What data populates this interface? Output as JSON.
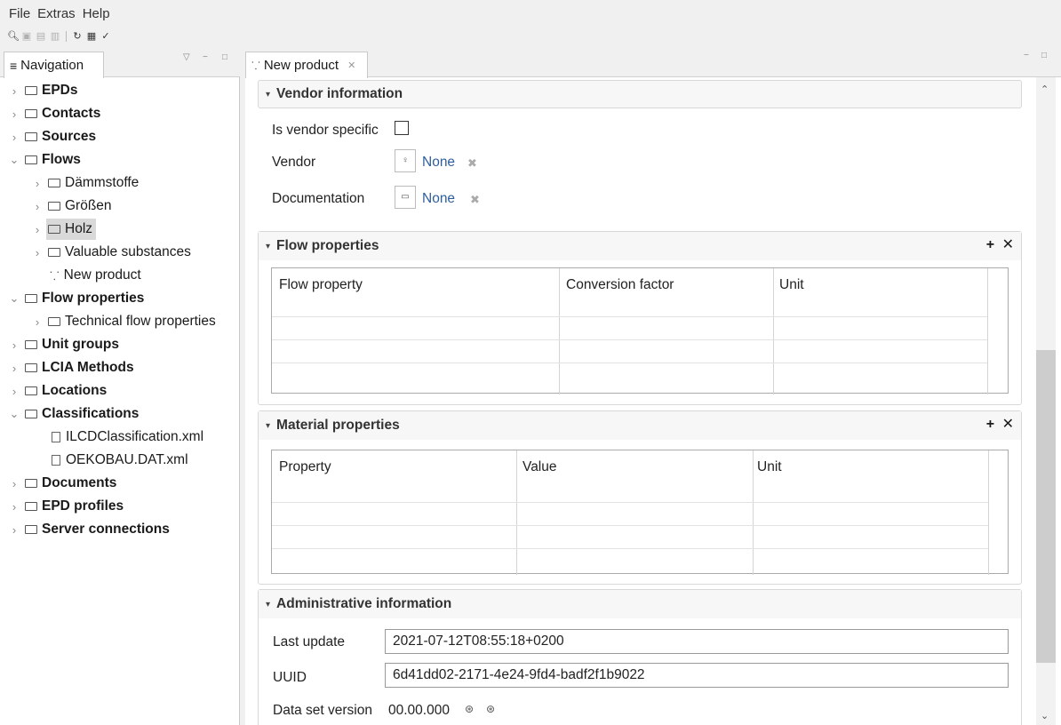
{
  "menubar": {
    "items": [
      "File",
      "Extras",
      "Help"
    ]
  },
  "toolbar": {
    "icons": [
      "search-icon",
      "save-icon",
      "save-as-icon",
      "save-all-icon",
      "refresh-icon",
      "validate-icon",
      "check-icon"
    ]
  },
  "navigation": {
    "tab_label": "Navigation",
    "tree": [
      {
        "label": "EPDs",
        "bold": true,
        "expanded": false,
        "level": 0,
        "kind": "folder"
      },
      {
        "label": "Contacts",
        "bold": true,
        "expanded": false,
        "level": 0,
        "kind": "folder"
      },
      {
        "label": "Sources",
        "bold": true,
        "expanded": false,
        "level": 0,
        "kind": "folder"
      },
      {
        "label": "Flows",
        "bold": true,
        "expanded": true,
        "level": 0,
        "kind": "folder"
      },
      {
        "label": "Dämmstoffe",
        "bold": false,
        "expanded": false,
        "level": 1,
        "kind": "folder"
      },
      {
        "label": "Größen",
        "bold": false,
        "expanded": false,
        "level": 1,
        "kind": "folder"
      },
      {
        "label": "Holz",
        "bold": false,
        "expanded": false,
        "level": 1,
        "kind": "folder",
        "selected": true
      },
      {
        "label": "Valuable substances",
        "bold": false,
        "expanded": false,
        "level": 1,
        "kind": "folder"
      },
      {
        "label": "New product",
        "bold": false,
        "level": 1,
        "kind": "product"
      },
      {
        "label": "Flow properties",
        "bold": true,
        "expanded": true,
        "level": 0,
        "kind": "folder"
      },
      {
        "label": "Technical flow properties",
        "bold": false,
        "expanded": false,
        "level": 1,
        "kind": "folder"
      },
      {
        "label": "Unit groups",
        "bold": true,
        "expanded": false,
        "level": 0,
        "kind": "folder"
      },
      {
        "label": "LCIA Methods",
        "bold": true,
        "expanded": false,
        "level": 0,
        "kind": "folder"
      },
      {
        "label": "Locations",
        "bold": true,
        "expanded": false,
        "level": 0,
        "kind": "folder"
      },
      {
        "label": "Classifications",
        "bold": true,
        "expanded": true,
        "level": 0,
        "kind": "folder"
      },
      {
        "label": "ILCDClassification.xml",
        "bold": false,
        "level": 1,
        "kind": "file"
      },
      {
        "label": "OEKOBAU.DAT.xml",
        "bold": false,
        "level": 1,
        "kind": "file"
      },
      {
        "label": "Documents",
        "bold": true,
        "expanded": false,
        "level": 0,
        "kind": "folder"
      },
      {
        "label": "EPD profiles",
        "bold": true,
        "expanded": false,
        "level": 0,
        "kind": "folder"
      },
      {
        "label": "Server connections",
        "bold": true,
        "expanded": false,
        "level": 0,
        "kind": "folder"
      }
    ]
  },
  "editor": {
    "tab_label": "New product",
    "vendor_section": {
      "title": "Vendor information",
      "vendor_specific_label": "Is vendor specific",
      "vendor_label": "Vendor",
      "vendor_value": "None",
      "documentation_label": "Documentation",
      "documentation_value": "None"
    },
    "flow_properties": {
      "title": "Flow properties",
      "columns": [
        "Flow property",
        "Conversion factor",
        "Unit"
      ]
    },
    "material_properties": {
      "title": "Material properties",
      "columns": [
        "Property",
        "Value",
        "Unit"
      ]
    },
    "admin": {
      "title": "Administrative information",
      "last_update_label": "Last update",
      "last_update_value": "2021-07-12T08:55:18+0200",
      "uuid_label": "UUID",
      "uuid_value": "6d41dd02-2171-4e24-9fd4-badf2f1b9022",
      "version_label": "Data set version",
      "version_value": "00.00.000"
    }
  },
  "colors": {
    "link": "#2e5e9e",
    "selection": "#d9d9d9"
  }
}
